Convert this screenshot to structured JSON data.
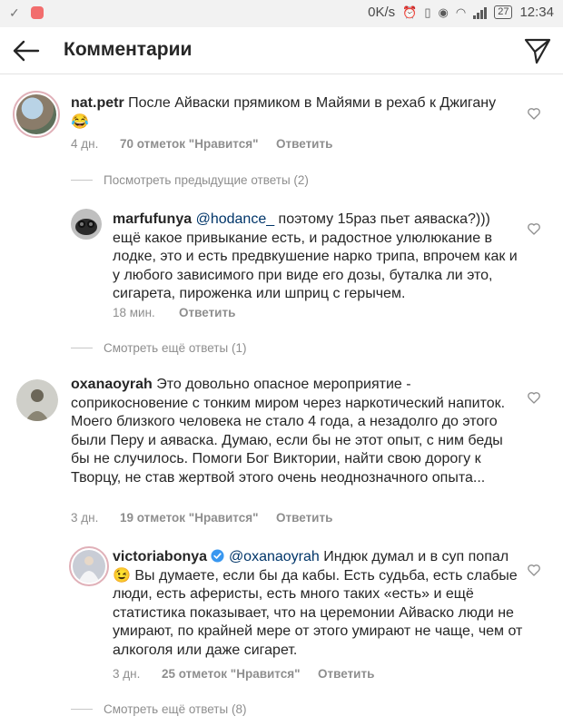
{
  "status_bar": {
    "speed": "0K/s",
    "battery": "27",
    "time": "12:34",
    "network": "4G"
  },
  "header": {
    "title": "Комментарии"
  },
  "comments": [
    {
      "username": "nat.petr",
      "text": "После Айваски прямиком в Майями в рехаб к Джигану😂",
      "time": "4 дн.",
      "likes": "70 отметок \"Нравится\"",
      "reply": "Ответить"
    },
    {
      "username": "marfufunya",
      "mention": "@hodance_",
      "text": " поэтому 15раз пьет аяваска?))) ещё какое привыкание есть, и радостное улюлюкание в лодке,  это и есть предвкушение нарко трипа,  впрочем как и у любого зависимого при виде его дозы, буталка ли это, сигарета, пироженка или шприц с герычем.",
      "time": "18 мин.",
      "reply": "Ответить"
    },
    {
      "username": "oxanaoyrah",
      "text": "Это довольно опасное мероприятие - соприкосновение с тонким миром через наркотический напиток. Моего близкого человека не стало 4 года, а незадолго до этого были Перу и аяваска. Думаю, если бы не этот опыт, с ним беды бы не случилось. Помоги Бог Виктории, найти свою дорогу к Творцу, не став жертвой этого очень неоднозначного опыта...",
      "time": "3 дн.",
      "likes": "19 отметок \"Нравится\"",
      "reply": "Ответить"
    },
    {
      "username": "victoriabonya",
      "mention": "@oxanaoyrah",
      "text": " Индюк думал и в суп попал 😉 Вы думаете, если бы да кабы. Есть судьба, есть слабые люди, есть аферисты, есть много таких «есть» и ещё статистика показывает, что на церемонии Айваско люди не умирают, по крайней мере от этого умирают не чаще, чем от алкоголя или даже сигарет.",
      "time": "3 дн.",
      "likes": "25 отметок \"Нравится\"",
      "reply": "Ответить"
    }
  ],
  "threads": {
    "previous_replies": "Посмотреть предыдущие ответы (2)",
    "more_replies_1": "Смотреть ещё ответы (1)",
    "more_replies_8": "Смотреть ещё ответы (8)"
  },
  "colors": {
    "text": "#262626",
    "meta": "#8e8e8e",
    "mention": "#003569",
    "verified": "#3897f0"
  }
}
